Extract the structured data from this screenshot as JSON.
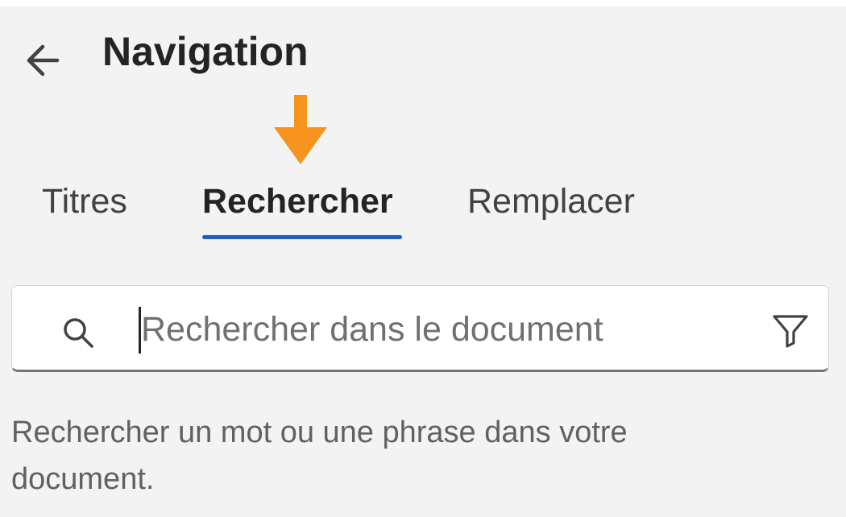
{
  "pane": {
    "title": "Navigation",
    "back_icon": "arrow-left-icon"
  },
  "annotation": {
    "icon": "arrow-down-icon",
    "color": "#f7941d"
  },
  "tabs": [
    {
      "label": "Titres",
      "active": false
    },
    {
      "label": "Rechercher",
      "active": true
    },
    {
      "label": "Remplacer",
      "active": false
    }
  ],
  "search": {
    "value": "",
    "placeholder": "Rechercher dans le document",
    "search_icon": "search-icon",
    "filter_icon": "filter-icon"
  },
  "help": {
    "text": "Rechercher un mot ou une phrase dans votre document."
  },
  "colors": {
    "accent": "#1f5fc5",
    "background": "#f3f3f3",
    "annotation": "#f7941d"
  }
}
